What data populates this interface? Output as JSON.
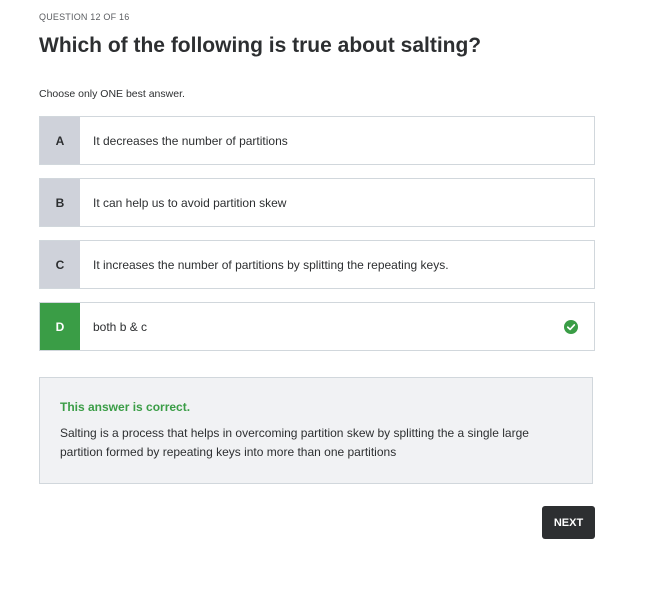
{
  "quiz": {
    "counter": "QUESTION 12 OF 16",
    "question": "Which of the following is true about salting?",
    "instruction": "Choose only ONE best answer.",
    "options": [
      {
        "letter": "A",
        "text": "It decreases the number of partitions",
        "selected": false
      },
      {
        "letter": "B",
        "text": "It can help us to avoid partition skew",
        "selected": false
      },
      {
        "letter": "C",
        "text": "It increases the number of partitions by splitting the repeating keys.",
        "selected": false
      },
      {
        "letter": "D",
        "text": "both b & c",
        "selected": true
      }
    ],
    "selected_icon": "check-circle-icon"
  },
  "feedback": {
    "status": "This answer is correct.",
    "explanation": "Salting is a process that helps in overcoming partition skew by splitting the a single large partition formed by repeating keys into more than one partitions"
  },
  "actions": {
    "next_label": "NEXT"
  },
  "colors": {
    "correct_green": "#3a9d46",
    "letter_gray": "#cfd2da",
    "button_dark": "#2d2f31",
    "feedback_bg": "#f1f2f4"
  }
}
